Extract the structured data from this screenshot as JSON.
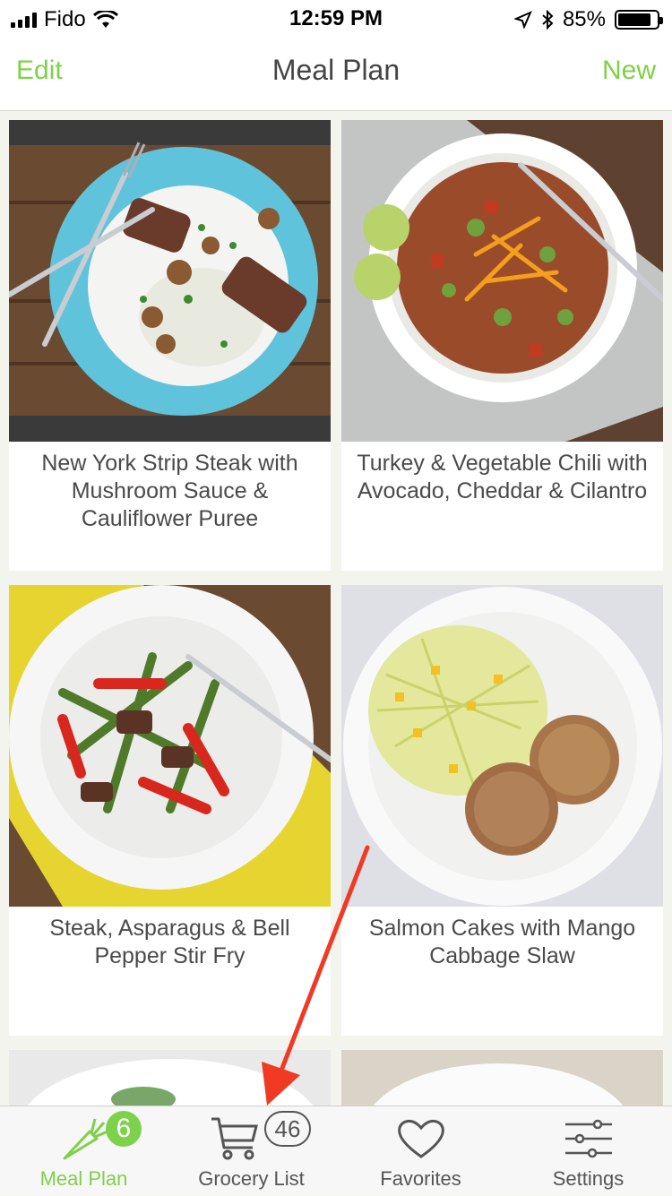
{
  "status_bar": {
    "carrier": "Fido",
    "time": "12:59 PM",
    "battery": "85%",
    "battery_level": 0.85
  },
  "nav": {
    "left_label": "Edit",
    "title": "Meal Plan",
    "right_label": "New"
  },
  "recipes": [
    {
      "title": "New York Strip Steak with Mushroom Sauce & Cauliflower Puree"
    },
    {
      "title": "Turkey & Vegetable Chili with Avocado, Cheddar & Cilantro"
    },
    {
      "title": "Steak, Asparagus & Bell Pepper Stir Fry"
    },
    {
      "title": "Salmon Cakes with Mango Cabbage Slaw"
    }
  ],
  "tabs": [
    {
      "label": "Meal Plan",
      "icon": "carrot-icon",
      "badge": "6",
      "active": true
    },
    {
      "label": "Grocery List",
      "icon": "cart-icon",
      "badge": "46",
      "active": false
    },
    {
      "label": "Favorites",
      "icon": "heart-icon",
      "active": false
    },
    {
      "label": "Settings",
      "icon": "sliders-icon",
      "active": false
    }
  ],
  "colors": {
    "accent": "#7ed14a",
    "annotation_arrow": "#f03a23"
  }
}
